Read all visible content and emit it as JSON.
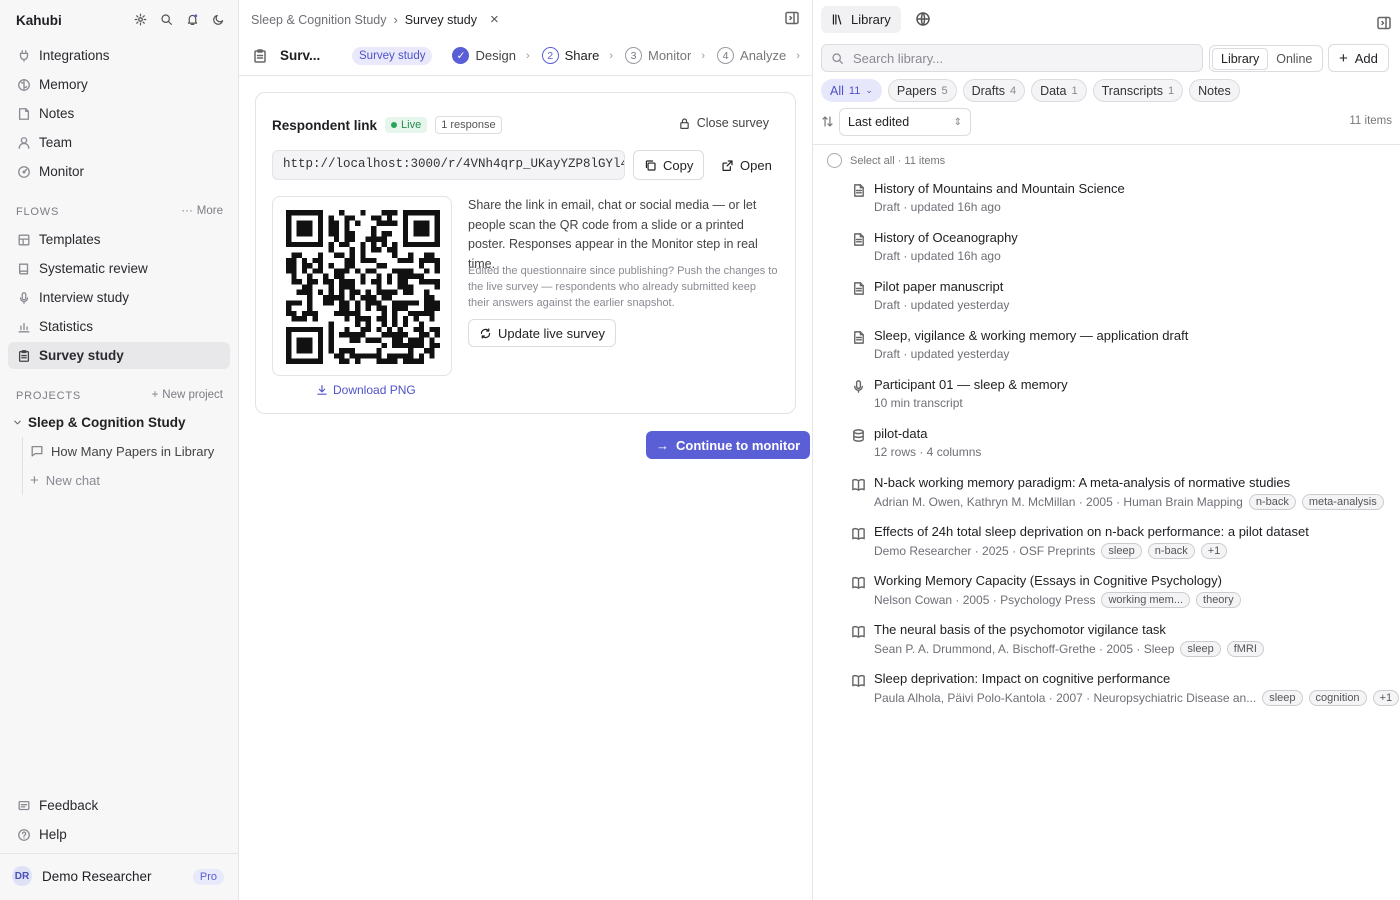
{
  "sidebar": {
    "brand": "Kahubi",
    "nav": [
      "Integrations",
      "Memory",
      "Notes",
      "Team",
      "Monitor"
    ],
    "flows_header": "FLOWS",
    "flows_more": "More",
    "flows": [
      "Templates",
      "Systematic review",
      "Interview study",
      "Statistics",
      "Survey study"
    ],
    "projects_header": "PROJECTS",
    "new_project": "New project",
    "project_name": "Sleep & Cognition Study",
    "project_chat": "How Many Papers in Library",
    "new_chat": "New chat",
    "feedback": "Feedback",
    "help": "Help",
    "user_initials": "DR",
    "user_name": "Demo Researcher",
    "plan": "Pro"
  },
  "center": {
    "breadcrumb_project": "Sleep & Cognition Study",
    "breadcrumb_current": "Survey study",
    "title_truncated": "Surv...",
    "type_pill": "Survey study",
    "steps": [
      {
        "num": "1",
        "label": "Design"
      },
      {
        "num": "2",
        "label": "Share"
      },
      {
        "num": "3",
        "label": "Monitor"
      },
      {
        "num": "4",
        "label": "Analyze"
      }
    ],
    "card": {
      "title": "Respondent link",
      "live": "Live",
      "responses": "1 response",
      "close": "Close survey",
      "link": "http://localhost:3000/r/4VNh4qrp_UKayYZP8lGYl4...",
      "copy": "Copy",
      "open": "Open",
      "download": "Download PNG",
      "description": "Share the link in email, chat or social media — or let people scan the QR code from a slide or a printed poster. Responses appear in the Monitor step in real time.",
      "note": "Edited the questionnaire since publishing? Push the changes to the live survey — respondents who already submitted keep their answers against the earlier snapshot.",
      "update": "Update live survey"
    },
    "cta": "Continue to monitor"
  },
  "library": {
    "tab": "Library",
    "search_placeholder": "Search library...",
    "seg_library": "Library",
    "seg_online": "Online",
    "add": "Add",
    "filters": [
      {
        "label": "All",
        "count": "11"
      },
      {
        "label": "Papers",
        "count": "5"
      },
      {
        "label": "Drafts",
        "count": "4"
      },
      {
        "label": "Data",
        "count": "1"
      },
      {
        "label": "Transcripts",
        "count": "1"
      },
      {
        "label": "Notes",
        "count": ""
      }
    ],
    "sort": "Last edited",
    "count": "11 items",
    "select_all": "Select all · 11 items",
    "items": [
      {
        "icon": "draft-icon",
        "title": "History of Mountains and Mountain Science",
        "meta": "Draft · updated 16h ago",
        "tags": []
      },
      {
        "icon": "draft-icon",
        "title": "History of Oceanography",
        "meta": "Draft · updated 16h ago",
        "tags": []
      },
      {
        "icon": "draft-icon",
        "title": "Pilot paper manuscript",
        "meta": "Draft · updated yesterday",
        "tags": []
      },
      {
        "icon": "draft-icon",
        "title": "Sleep, vigilance & working memory — application draft",
        "meta": "Draft · updated yesterday",
        "tags": []
      },
      {
        "icon": "mic-icon",
        "title": "Participant 01 — sleep & memory",
        "meta": "10 min transcript",
        "tags": []
      },
      {
        "icon": "database-icon",
        "title": "pilot-data",
        "meta": "12 rows · 4 columns",
        "tags": []
      },
      {
        "icon": "book-icon",
        "title": "N-back working memory paradigm: A meta-analysis of normative studies",
        "meta": "Adrian M. Owen, Kathryn M. McMillan · 2005 · Human Brain Mapping",
        "tags": [
          "n-back",
          "meta-analysis"
        ]
      },
      {
        "icon": "book-icon",
        "title": "Effects of 24h total sleep deprivation on n-back performance: a pilot dataset",
        "meta": "Demo Researcher · 2025 · OSF Preprints",
        "tags": [
          "sleep",
          "n-back",
          "+1"
        ]
      },
      {
        "icon": "book-icon",
        "title": "Working Memory Capacity (Essays in Cognitive Psychology)",
        "meta": "Nelson Cowan · 2005 · Psychology Press",
        "tags": [
          "working mem...",
          "theory"
        ]
      },
      {
        "icon": "book-icon",
        "title": "The neural basis of the psychomotor vigilance task",
        "meta": "Sean P. A. Drummond, A. Bischoff-Grethe · 2005 · Sleep",
        "tags": [
          "sleep",
          "fMRI"
        ]
      },
      {
        "icon": "book-icon",
        "title": "Sleep deprivation: Impact on cognitive performance",
        "meta": "Paula Alhola, Päivi Polo-Kantola · 2007 · Neuropsychiatric Disease an...",
        "tags": [
          "sleep",
          "cognition",
          "+1"
        ]
      }
    ]
  },
  "colors": {
    "accent": "#5b5fd6",
    "live": "#2aa35a"
  }
}
